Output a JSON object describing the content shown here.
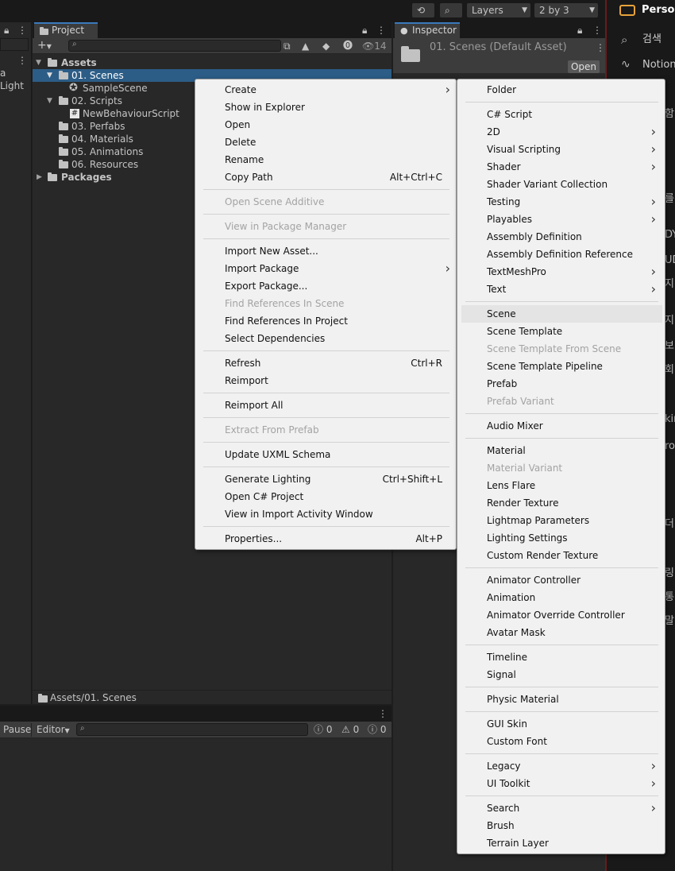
{
  "toolbar": {
    "layers_label": "Layers",
    "layout_label": "2 by 3"
  },
  "left_strip": {
    "items": [
      "a",
      "Light"
    ]
  },
  "project": {
    "tab_label": "Project",
    "hidden_count": "14",
    "tree": [
      {
        "label": "Assets",
        "level": 0
      },
      {
        "label": "01. Scenes",
        "level": 1
      },
      {
        "label": "SampleScene",
        "level": 2
      },
      {
        "label": "02. Scripts",
        "level": 1
      },
      {
        "label": "NewBehaviourScript",
        "level": 2
      },
      {
        "label": "03. Perfabs",
        "level": 1
      },
      {
        "label": "04. Materials",
        "level": 1
      },
      {
        "label": "05. Animations",
        "level": 1
      },
      {
        "label": "06. Resources",
        "level": 1
      },
      {
        "label": "Packages",
        "level": 0
      }
    ],
    "footer_path": "Assets/01. Scenes"
  },
  "inspector": {
    "tab_label": "Inspector",
    "asset_title": "01. Scenes (Default Asset)",
    "open_label": "Open"
  },
  "console": {
    "pause_label": "Pause",
    "editor_label": "Editor",
    "info_count": "0",
    "warn_count": "0",
    "error_count": "0"
  },
  "browser_side": {
    "profile_label": "Person",
    "search_label": "검색",
    "notion_label": "Notion",
    "partial_chars": [
      "함",
      "를",
      "DY",
      "UD",
      "지",
      "지",
      "보",
      "회",
      "kin",
      "ro-",
      "더",
      "링",
      "통",
      "말"
    ]
  },
  "context_menu": {
    "items": [
      {
        "label": "Create",
        "shortcut": "",
        "submenu": true,
        "disabled": false
      },
      {
        "label": "Show in Explorer",
        "shortcut": "",
        "submenu": false,
        "disabled": false
      },
      {
        "label": "Open",
        "shortcut": "",
        "submenu": false,
        "disabled": false
      },
      {
        "label": "Delete",
        "shortcut": "",
        "submenu": false,
        "disabled": false
      },
      {
        "label": "Rename",
        "shortcut": "",
        "submenu": false,
        "disabled": false
      },
      {
        "label": "Copy Path",
        "shortcut": "Alt+Ctrl+C",
        "submenu": false,
        "disabled": false
      },
      {
        "label": "Open Scene Additive",
        "shortcut": "",
        "submenu": false,
        "disabled": true
      },
      {
        "label": "View in Package Manager",
        "shortcut": "",
        "submenu": false,
        "disabled": true
      },
      {
        "label": "Import New Asset...",
        "shortcut": "",
        "submenu": false,
        "disabled": false
      },
      {
        "label": "Import Package",
        "shortcut": "",
        "submenu": true,
        "disabled": false
      },
      {
        "label": "Export Package...",
        "shortcut": "",
        "submenu": false,
        "disabled": false
      },
      {
        "label": "Find References In Scene",
        "shortcut": "",
        "submenu": false,
        "disabled": true
      },
      {
        "label": "Find References In Project",
        "shortcut": "",
        "submenu": false,
        "disabled": false
      },
      {
        "label": "Select Dependencies",
        "shortcut": "",
        "submenu": false,
        "disabled": false
      },
      {
        "label": "Refresh",
        "shortcut": "Ctrl+R",
        "submenu": false,
        "disabled": false
      },
      {
        "label": "Reimport",
        "shortcut": "",
        "submenu": false,
        "disabled": false
      },
      {
        "label": "Reimport All",
        "shortcut": "",
        "submenu": false,
        "disabled": false
      },
      {
        "label": "Extract From Prefab",
        "shortcut": "",
        "submenu": false,
        "disabled": true
      },
      {
        "label": "Update UXML Schema",
        "shortcut": "",
        "submenu": false,
        "disabled": false
      },
      {
        "label": "Generate Lighting",
        "shortcut": "Ctrl+Shift+L",
        "submenu": false,
        "disabled": false
      },
      {
        "label": "Open C# Project",
        "shortcut": "",
        "submenu": false,
        "disabled": false
      },
      {
        "label": "View in Import Activity Window",
        "shortcut": "",
        "submenu": false,
        "disabled": false
      },
      {
        "label": "Properties...",
        "shortcut": "Alt+P",
        "submenu": false,
        "disabled": false
      }
    ]
  },
  "create_submenu": {
    "items": [
      {
        "label": "Folder",
        "submenu": false,
        "disabled": false
      },
      {
        "label": "C# Script",
        "submenu": false,
        "disabled": false
      },
      {
        "label": "2D",
        "submenu": true,
        "disabled": false
      },
      {
        "label": "Visual Scripting",
        "submenu": true,
        "disabled": false
      },
      {
        "label": "Shader",
        "submenu": true,
        "disabled": false
      },
      {
        "label": "Shader Variant Collection",
        "submenu": false,
        "disabled": false
      },
      {
        "label": "Testing",
        "submenu": true,
        "disabled": false
      },
      {
        "label": "Playables",
        "submenu": true,
        "disabled": false
      },
      {
        "label": "Assembly Definition",
        "submenu": false,
        "disabled": false
      },
      {
        "label": "Assembly Definition Reference",
        "submenu": false,
        "disabled": false
      },
      {
        "label": "TextMeshPro",
        "submenu": true,
        "disabled": false
      },
      {
        "label": "Text",
        "submenu": true,
        "disabled": false
      },
      {
        "label": "Scene",
        "submenu": false,
        "disabled": false,
        "highlighted": true
      },
      {
        "label": "Scene Template",
        "submenu": false,
        "disabled": false
      },
      {
        "label": "Scene Template From Scene",
        "submenu": false,
        "disabled": true
      },
      {
        "label": "Scene Template Pipeline",
        "submenu": false,
        "disabled": false
      },
      {
        "label": "Prefab",
        "submenu": false,
        "disabled": false
      },
      {
        "label": "Prefab Variant",
        "submenu": false,
        "disabled": true
      },
      {
        "label": "Audio Mixer",
        "submenu": false,
        "disabled": false
      },
      {
        "label": "Material",
        "submenu": false,
        "disabled": false
      },
      {
        "label": "Material Variant",
        "submenu": false,
        "disabled": true
      },
      {
        "label": "Lens Flare",
        "submenu": false,
        "disabled": false
      },
      {
        "label": "Render Texture",
        "submenu": false,
        "disabled": false
      },
      {
        "label": "Lightmap Parameters",
        "submenu": false,
        "disabled": false
      },
      {
        "label": "Lighting Settings",
        "submenu": false,
        "disabled": false
      },
      {
        "label": "Custom Render Texture",
        "submenu": false,
        "disabled": false
      },
      {
        "label": "Animator Controller",
        "submenu": false,
        "disabled": false
      },
      {
        "label": "Animation",
        "submenu": false,
        "disabled": false
      },
      {
        "label": "Animator Override Controller",
        "submenu": false,
        "disabled": false
      },
      {
        "label": "Avatar Mask",
        "submenu": false,
        "disabled": false
      },
      {
        "label": "Timeline",
        "submenu": false,
        "disabled": false
      },
      {
        "label": "Signal",
        "submenu": false,
        "disabled": false
      },
      {
        "label": "Physic Material",
        "submenu": false,
        "disabled": false
      },
      {
        "label": "GUI Skin",
        "submenu": false,
        "disabled": false
      },
      {
        "label": "Custom Font",
        "submenu": false,
        "disabled": false
      },
      {
        "label": "Legacy",
        "submenu": true,
        "disabled": false
      },
      {
        "label": "UI Toolkit",
        "submenu": true,
        "disabled": false
      },
      {
        "label": "Search",
        "submenu": true,
        "disabled": false
      },
      {
        "label": "Brush",
        "submenu": false,
        "disabled": false
      },
      {
        "label": "Terrain Layer",
        "submenu": false,
        "disabled": false
      }
    ]
  }
}
